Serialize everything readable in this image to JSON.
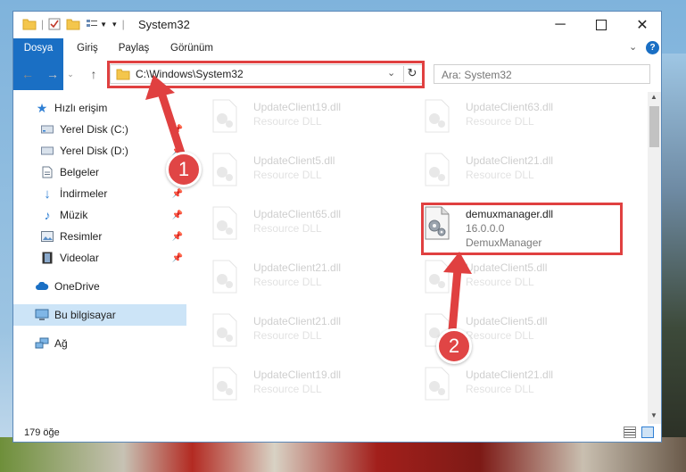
{
  "window": {
    "title": "System32"
  },
  "ribbon": {
    "tabs": [
      "Dosya",
      "Giriş",
      "Paylaş",
      "Görünüm"
    ]
  },
  "navigation": {
    "address_path": "C:\\Windows\\System32",
    "search_placeholder": "Ara: System32"
  },
  "sidebar": {
    "items": [
      {
        "label": "Hızlı erişim",
        "icon": "star-icon"
      },
      {
        "label": "Yerel Disk (C:)",
        "icon": "drive-icon",
        "pinned": true
      },
      {
        "label": "Yerel Disk (D:)",
        "icon": "drive-icon",
        "pinned": true
      },
      {
        "label": "Belgeler",
        "icon": "documents-icon",
        "pinned": true
      },
      {
        "label": "İndirmeler",
        "icon": "download-icon",
        "pinned": true
      },
      {
        "label": "Müzik",
        "icon": "music-icon",
        "pinned": true
      },
      {
        "label": "Resimler",
        "icon": "pictures-icon",
        "pinned": true
      },
      {
        "label": "Videolar",
        "icon": "video-icon",
        "pinned": true
      },
      {
        "label": "OneDrive",
        "icon": "cloud-icon"
      },
      {
        "label": "Bu bilgisayar",
        "icon": "computer-icon",
        "selected": true
      },
      {
        "label": "Ağ",
        "icon": "network-icon"
      }
    ]
  },
  "files": [
    {
      "name": "UpdateClient19.dll",
      "type": "Resource DLL",
      "highlighted": false
    },
    {
      "name": "UpdateClient63.dll",
      "type": "Resource DLL",
      "highlighted": false
    },
    {
      "name": "UpdateClient5.dll",
      "type": "Resource DLL",
      "highlighted": false
    },
    {
      "name": "UpdateClient21.dll",
      "type": "Resource DLL",
      "highlighted": false
    },
    {
      "name": "UpdateClient65.dll",
      "type": "Resource DLL",
      "highlighted": false
    },
    {
      "name": "demuxmanager.dll",
      "version": "16.0.0.0",
      "type": "DemuxManager",
      "highlighted": true
    },
    {
      "name": "UpdateClient21.dll",
      "type": "Resource DLL",
      "highlighted": false
    },
    {
      "name": "UpdateClient5.dll",
      "type": "Resource DLL",
      "highlighted": false
    },
    {
      "name": "UpdateClient21.dll",
      "type": "Resource DLL",
      "highlighted": false
    },
    {
      "name": "UpdateClient5.dll",
      "type": "Resource DLL",
      "highlighted": false
    },
    {
      "name": "UpdateClient19.dll",
      "type": "Resource DLL",
      "highlighted": false
    },
    {
      "name": "UpdateClient21.dll",
      "type": "Resource DLL",
      "highlighted": false
    }
  ],
  "status": {
    "item_count": "179 öğe"
  },
  "annotations": {
    "step1": "1",
    "step2": "2",
    "color": "#e04040"
  }
}
